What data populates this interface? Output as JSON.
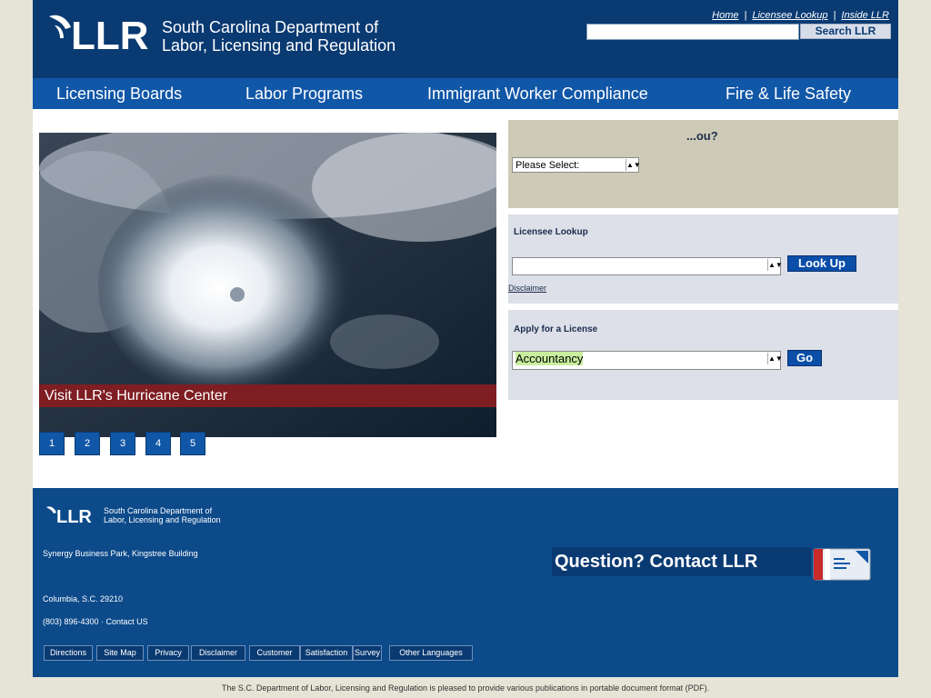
{
  "header": {
    "logo_letters": "LLR",
    "org_line1": "South Carolina Department of",
    "org_line2": "Labor, Licensing and Regulation",
    "top_links": [
      "Home",
      "Licensee Lookup",
      "Inside LLR"
    ],
    "search_value": "",
    "search_button": "Search LLR"
  },
  "nav": {
    "items": [
      "Licensing Boards",
      "Labor Programs",
      "Immigrant Worker Compliance",
      "Fire & Life Safety"
    ]
  },
  "hero": {
    "caption": "Visit LLR's Hurricane Center",
    "pager": [
      "1",
      "2",
      "3",
      "4",
      "5"
    ]
  },
  "panels": {
    "p1": {
      "title": "...ou?",
      "select_value": "Please Select:"
    },
    "p2": {
      "title": "Licensee Lookup",
      "select_value": "",
      "button": "Look Up",
      "link": "Disclaimer"
    },
    "p3": {
      "title": "Apply for a License",
      "select_value": "Accountancy",
      "button": "Go"
    }
  },
  "footer": {
    "logo_letters": "LLR",
    "org_line1": "South Carolina Department of",
    "org_line2": "Labor, Licensing and Regulation",
    "address1": "Synergy Business Park, Kingstree Building",
    "address2": "Columbia, S.C. 29210",
    "phone": "(803) 896-4300",
    "contact_us": "Contact US",
    "links": [
      "Directions",
      "Site Map",
      "Privacy",
      "Disclaimer",
      "Customer",
      "Satisfaction",
      "Survey",
      "Other Languages"
    ],
    "contact_banner": "Question? Contact LLR"
  },
  "bottom_note": "The S.C. Department of Labor, Licensing and Regulation is pleased to provide various publications in portable document format (PDF).",
  "colors": {
    "header_bg": "#0a3a72",
    "nav_bg": "#1157a7",
    "caption_bg": "#7e1d22",
    "footer_bg": "#0c4a8a"
  }
}
